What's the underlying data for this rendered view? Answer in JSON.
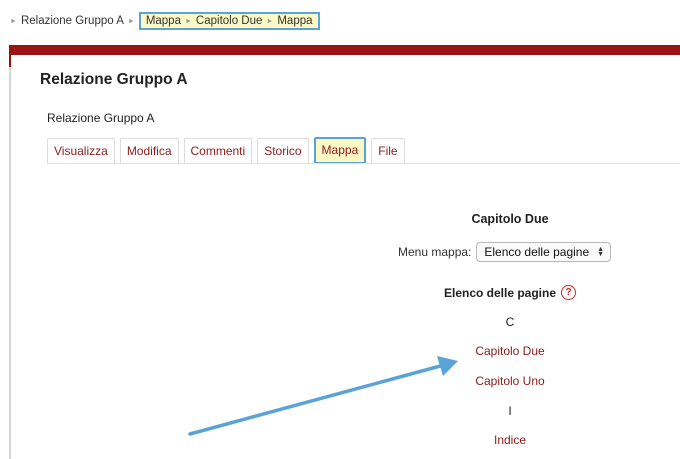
{
  "breadcrumb": {
    "items": [
      "Relazione Gruppo A"
    ],
    "highlighted": [
      "Mappa",
      "Capitolo Due",
      "Mappa"
    ],
    "separator": "►"
  },
  "page": {
    "title": "Relazione Gruppo A",
    "subtitle": "Relazione Gruppo A"
  },
  "tabs": [
    {
      "label": "Visualizza"
    },
    {
      "label": "Modifica"
    },
    {
      "label": "Commenti"
    },
    {
      "label": "Storico"
    },
    {
      "label": "Mappa",
      "active": true
    },
    {
      "label": "File"
    }
  ],
  "map": {
    "title": "Capitolo Due",
    "menu_label": "Menu mappa:",
    "menu_selected": "Elenco delle pagine",
    "list_title": "Elenco delle pagine",
    "help_icon_glyph": "?",
    "groups": [
      {
        "letter": "C",
        "pages": [
          "Capitolo Due",
          "Capitolo Uno"
        ]
      },
      {
        "letter": "I",
        "pages": [
          "Indice"
        ]
      }
    ]
  },
  "colors": {
    "accent_red": "#9b1414",
    "link": "#8c1a1a",
    "highlight_bg": "#fcf8c6",
    "highlight_border": "#5aa3d8",
    "annotation_arrow": "#5aa3d8"
  }
}
